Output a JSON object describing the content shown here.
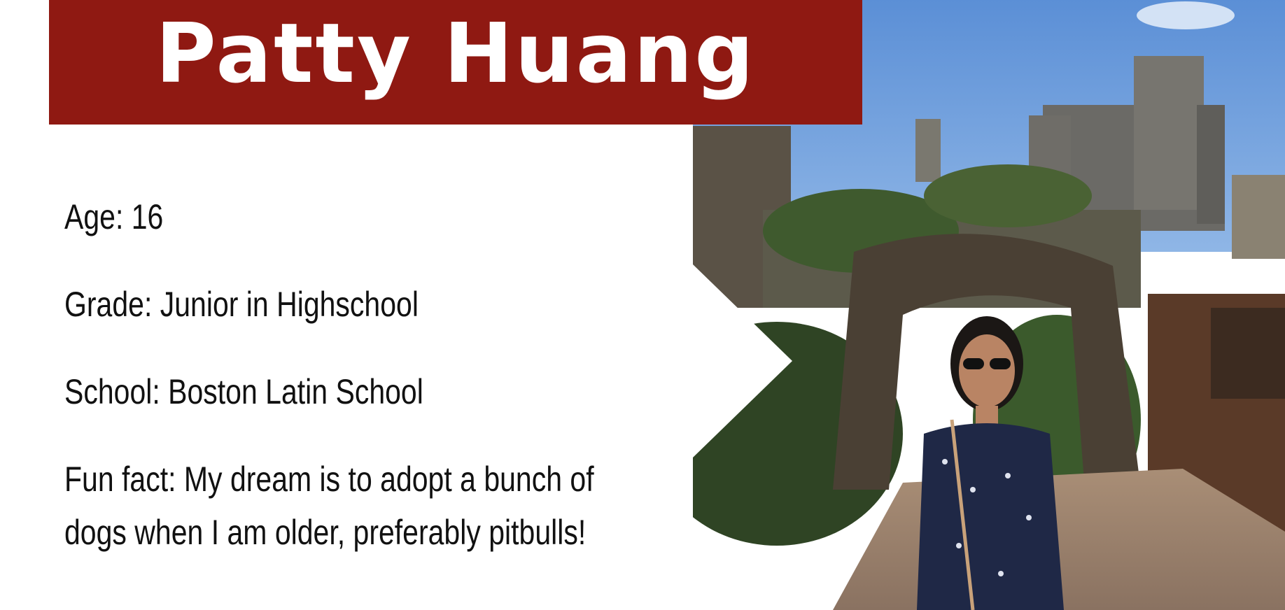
{
  "title": "Patty Huang",
  "info": {
    "age": "Age: 16",
    "grade": "Grade: Junior in Highschool",
    "school": "School: Boston Latin School",
    "fun_fact_line1": "Fun fact: My dream is to adopt a bunch of",
    "fun_fact_line2": "dogs when I am older, preferably pitbulls!"
  },
  "colors": {
    "banner": "#8f1912",
    "title_text": "#ffffff",
    "body_text": "#111111",
    "background": "#ffffff"
  },
  "photo": {
    "subject": "person-in-front-of-castle-photo"
  }
}
